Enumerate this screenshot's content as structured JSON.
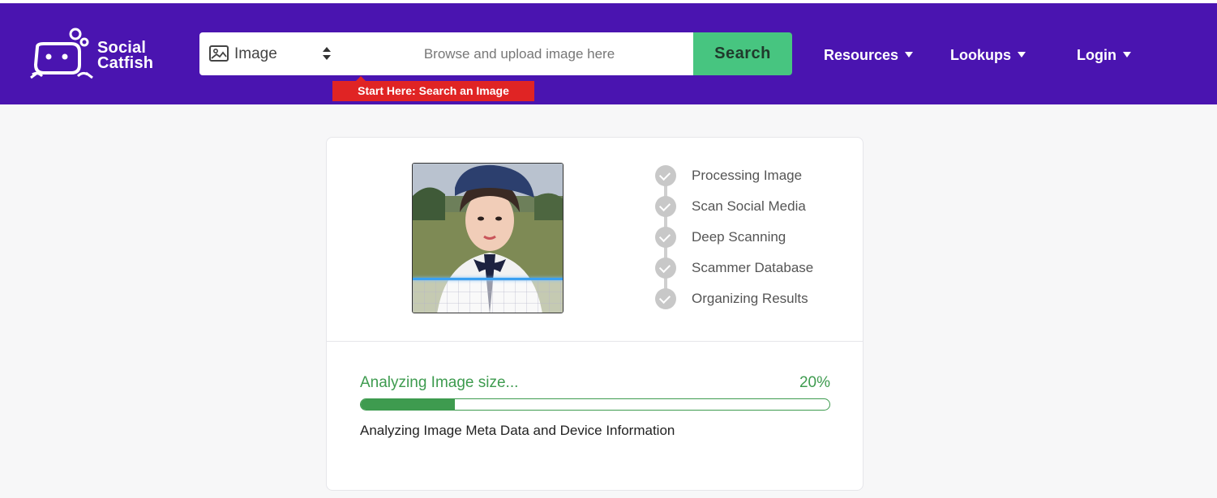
{
  "brand": {
    "name_line1": "Social",
    "name_line2": "Catfish",
    "logo_icon": "catfish-logo-icon"
  },
  "search": {
    "type_label": "Image",
    "type_icon": "image-icon",
    "placeholder": "Browse and upload image here",
    "button_label": "Search",
    "tooltip": "Start Here: Search an Image"
  },
  "nav": {
    "items": [
      {
        "label": "Resources"
      },
      {
        "label": "Lookups"
      },
      {
        "label": "Login"
      }
    ]
  },
  "scan": {
    "steps": [
      {
        "label": "Processing Image"
      },
      {
        "label": "Scan Social Media"
      },
      {
        "label": "Deep Scanning"
      },
      {
        "label": "Scammer Database"
      },
      {
        "label": "Organizing Results"
      }
    ],
    "status_title": "Analyzing Image size...",
    "progress_percent": 20,
    "progress_label": "20%",
    "status_detail": "Analyzing Image Meta Data and Device Information"
  },
  "colors": {
    "header_bg": "#4a14b0",
    "search_button": "#47c580",
    "tooltip_bg": "#e02424",
    "progress": "#3e9b4f"
  }
}
